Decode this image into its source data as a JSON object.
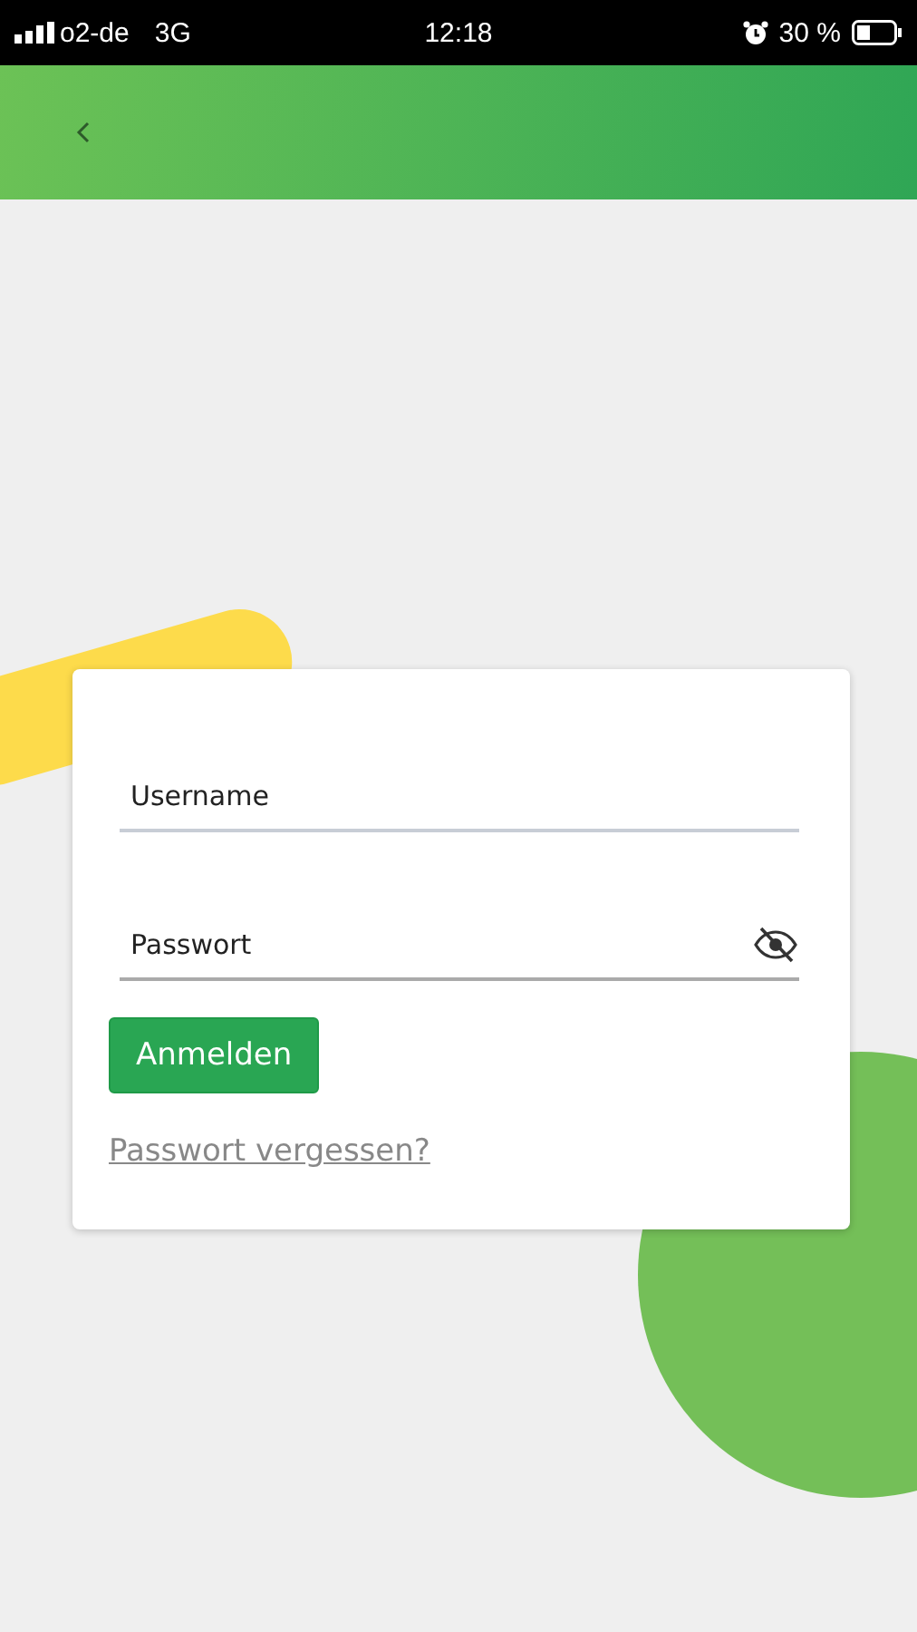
{
  "status_bar": {
    "carrier": "o2-de",
    "network": "3G",
    "time": "12:18",
    "battery": "30 %"
  },
  "login": {
    "username": {
      "placeholder": "Username"
    },
    "password": {
      "placeholder": "Passwort"
    },
    "submit": "Anmelden",
    "forgot_link": "Passwort vergessen?"
  }
}
